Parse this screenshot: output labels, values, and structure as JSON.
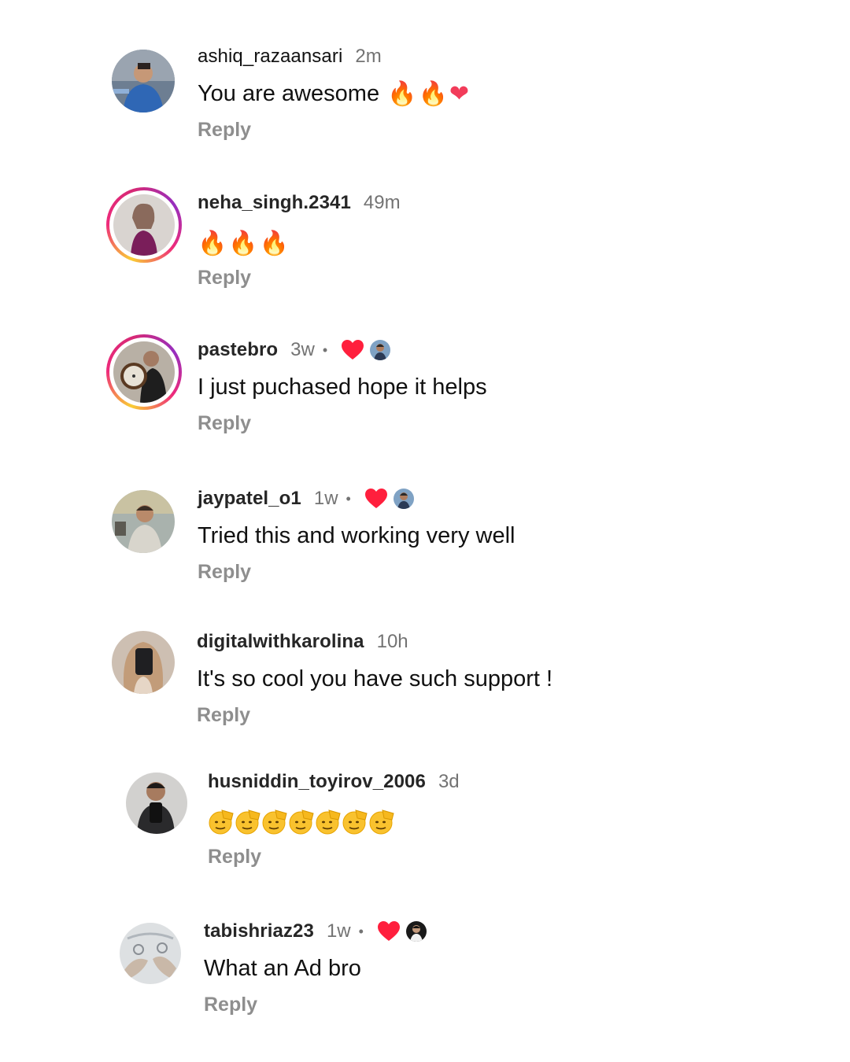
{
  "comments": [
    {
      "username": "ashiq_razaansari",
      "time": "2m",
      "text": "You are awesome",
      "emoji": [
        "🔥",
        "🔥",
        "❤"
      ],
      "reply_label": "Reply",
      "has_story_ring": false,
      "liked_by_creator": false
    },
    {
      "username": "neha_singh.2341",
      "time": "49m",
      "text": "",
      "emoji": [
        "🔥",
        "🔥",
        "🔥"
      ],
      "reply_label": "Reply",
      "has_story_ring": true,
      "liked_by_creator": false
    },
    {
      "username": "pastebro",
      "time": "3w",
      "separator": "•",
      "text": "I just puchased hope it helps",
      "reply_label": "Reply",
      "has_story_ring": true,
      "liked_by_creator": true
    },
    {
      "username": "jaypatel_o1",
      "time": "1w",
      "separator": "•",
      "text": "Tried this and working very well",
      "reply_label": "Reply",
      "has_story_ring": false,
      "liked_by_creator": true
    },
    {
      "username": "digitalwithkarolina",
      "time": "10h",
      "text": "It's so cool you have such support !",
      "reply_label": "Reply",
      "has_story_ring": false,
      "liked_by_creator": false
    },
    {
      "username": "husniddin_toyirov_2006",
      "time": "3d",
      "text": "",
      "emoji_icon": "saluting-face-icon",
      "emoji_count": 7,
      "reply_label": "Reply",
      "has_story_ring": false,
      "liked_by_creator": false
    },
    {
      "username": "tabishriaz23",
      "time": "1w",
      "separator": "•",
      "text": "What an Ad bro",
      "reply_label": "Reply",
      "has_story_ring": false,
      "liked_by_creator": true
    }
  ],
  "colors": {
    "like_heart": "#ff1f3d",
    "secondary_text": "#737373",
    "story_ring_start": "#f9ce34",
    "story_ring_end": "#962fbf"
  }
}
